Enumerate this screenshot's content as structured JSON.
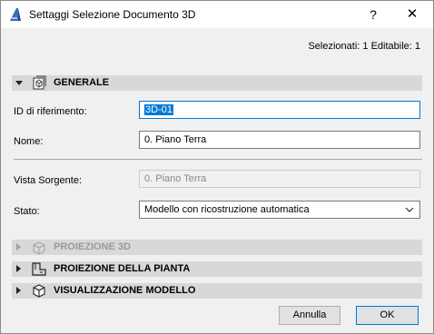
{
  "window": {
    "title": "Settaggi Selezione Documento 3D",
    "help": "?",
    "close": "✕"
  },
  "selection_info": "Selezionati: 1 Editabile: 1",
  "sections": {
    "generale": "GENERALE",
    "proiezione3d": "PROIEZIONE 3D",
    "proiezione_pianta": "PROIEZIONE DELLA PIANTA",
    "visualizzazione": "VISUALIZZAZIONE MODELLO"
  },
  "fields": {
    "id_label": "ID di riferimento:",
    "id_value": "3D-01",
    "nome_label": "Nome:",
    "nome_value": "0. Piano Terra",
    "vista_label": "Vista Sorgente:",
    "vista_value": "0. Piano Terra",
    "stato_label": "Stato:",
    "stato_value": "Modello con ricostruzione automatica"
  },
  "buttons": {
    "cancel": "Annulla",
    "ok": "OK"
  },
  "colors": {
    "accent": "#0078d7",
    "section_bg": "#d8d8d8",
    "dialog_bg": "#f0f0f0"
  },
  "icons": {
    "app": "archicad-icon",
    "generale": "3d-document-icon",
    "proiezione3d": "3d-projection-icon",
    "pianta": "floor-plan-icon",
    "modello": "model-cube-icon"
  }
}
